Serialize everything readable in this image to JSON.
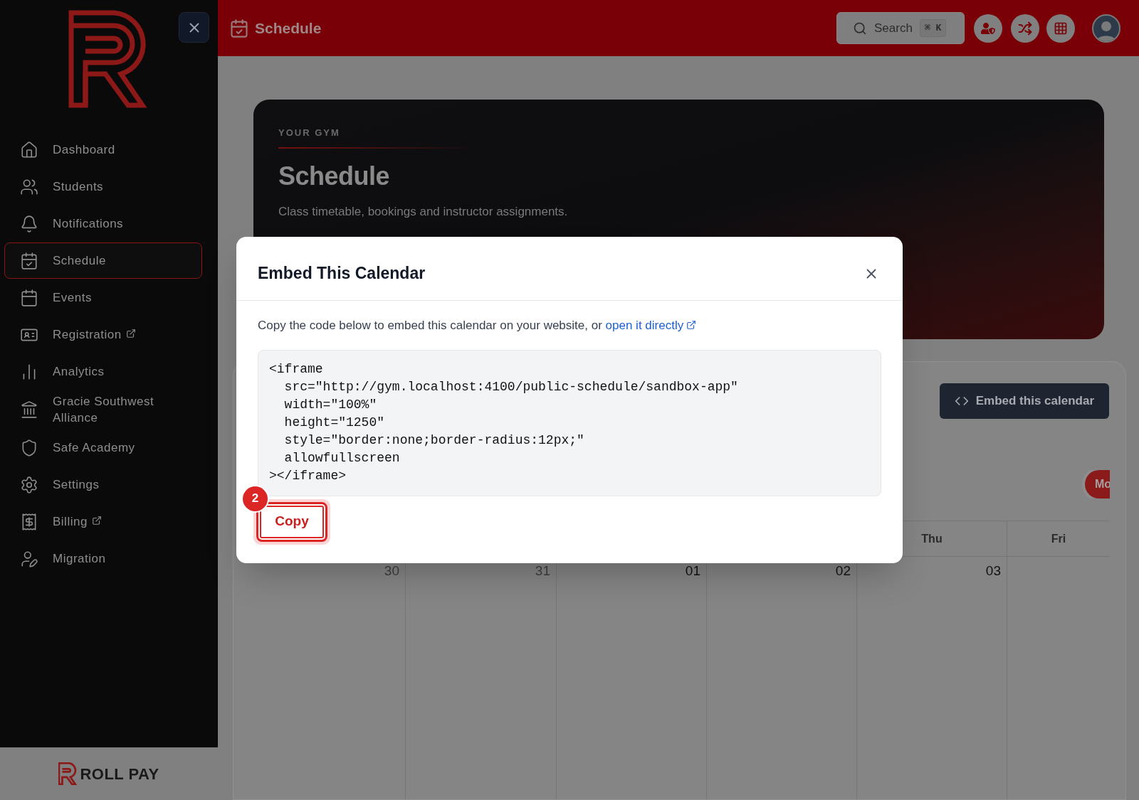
{
  "sidebar": {
    "items": [
      {
        "label": "Dashboard",
        "selected": false,
        "external": false
      },
      {
        "label": "Students",
        "selected": false,
        "external": false
      },
      {
        "label": "Notifications",
        "selected": false,
        "external": false
      },
      {
        "label": "Schedule",
        "selected": true,
        "external": false
      },
      {
        "label": "Events",
        "selected": false,
        "external": false
      },
      {
        "label": "Registration",
        "selected": false,
        "external": true
      },
      {
        "label": "Analytics",
        "selected": false,
        "external": false
      },
      {
        "label": "Gracie Southwest Alliance",
        "selected": false,
        "external": false
      },
      {
        "label": "Safe Academy",
        "selected": false,
        "external": false
      },
      {
        "label": "Settings",
        "selected": false,
        "external": false
      },
      {
        "label": "Billing",
        "selected": false,
        "external": true
      },
      {
        "label": "Migration",
        "selected": false,
        "external": false
      }
    ],
    "footer_brand": "ROLL PAY"
  },
  "header": {
    "title": "Schedule",
    "search": {
      "placeholder": "Search",
      "shortcut": "⌘ K"
    }
  },
  "hero": {
    "eyebrow": "YOUR GYM",
    "title": "Schedule",
    "subtitle": "Class timetable, bookings and instructor assignments."
  },
  "calendar": {
    "embed_button": "Embed this calendar",
    "view_button": "Mo",
    "day_headers": [
      "Thu",
      "Fri"
    ],
    "dates": [
      {
        "label": "30",
        "outside_month": true
      },
      {
        "label": "31",
        "outside_month": true
      },
      {
        "label": "01",
        "outside_month": false
      },
      {
        "label": "02",
        "outside_month": false
      },
      {
        "label": "03",
        "outside_month": false
      }
    ]
  },
  "modal": {
    "title": "Embed This Calendar",
    "intro": "Copy the code below to embed this calendar on your website, or ",
    "link": "open it directly",
    "code": "<iframe\n  src=\"http://gym.localhost:4100/public-schedule/sandbox-app\"\n  width=\"100%\"\n  height=\"1250\"\n  style=\"border:none;border-radius:12px;\"\n  allowfullscreen\n></iframe>",
    "copy_button": "Copy",
    "step_badge": "2"
  }
}
